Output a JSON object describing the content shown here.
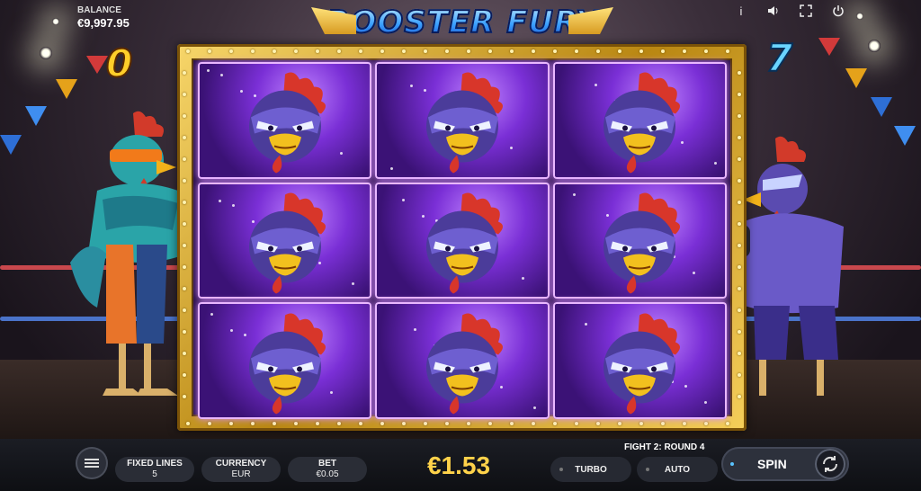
{
  "game": {
    "logo_text": "ROOSTER FURY"
  },
  "balance": {
    "label": "BALANCE",
    "value": "€9,997.95"
  },
  "top_icons": [
    "info-icon",
    "sound-icon",
    "fullscreen-icon",
    "power-icon"
  ],
  "scores": {
    "left": "0",
    "right": "7"
  },
  "reels": {
    "columns": 3,
    "rows": 3,
    "symbols": [
      [
        "masked-rooster",
        "masked-rooster",
        "masked-rooster"
      ],
      [
        "masked-rooster",
        "masked-rooster",
        "masked-rooster"
      ],
      [
        "masked-rooster",
        "masked-rooster",
        "masked-rooster"
      ]
    ]
  },
  "bottom_bar": {
    "fixed_lines": {
      "label": "FIXED LINES",
      "value": "5"
    },
    "currency": {
      "label": "CURRENCY",
      "value": "EUR"
    },
    "bet": {
      "label": "BET",
      "value": "€0.05"
    },
    "win_amount": "€1.53",
    "fight_round": "FIGHT 2: ROUND 4",
    "turbo_label": "TURBO",
    "auto_label": "AUTO",
    "spin_label": "SPIN"
  },
  "colors": {
    "score_left": "#ffce2a",
    "score_right": "#6ad4ff",
    "win_amount": "#ffd24a",
    "frame_gold": "#d9a937",
    "reel_purple": "#7a2fd6"
  }
}
